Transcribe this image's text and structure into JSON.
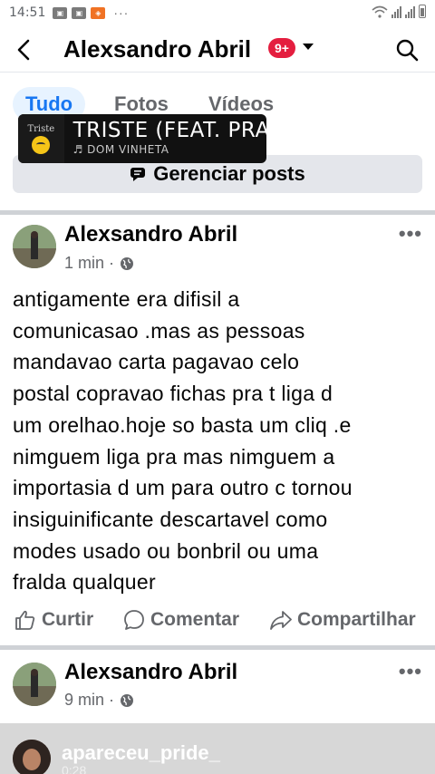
{
  "status_bar": {
    "time": "14:51",
    "more_indicator": "···",
    "notification_icons": [
      "gallery-icon",
      "gallery-icon",
      "app-notification-icon"
    ]
  },
  "header": {
    "title": "Alexsandro Abril",
    "badge": "9+",
    "back_icon": "arrow-left-icon",
    "search_icon": "search-icon"
  },
  "tabs": [
    {
      "label": "Tudo",
      "active": true
    },
    {
      "label": "Fotos",
      "active": false
    },
    {
      "label": "Vídeos",
      "active": false
    }
  ],
  "music_sticker": {
    "album_text": "Triste",
    "song": "TRISTE (FEAT. PRAV",
    "artist": "♬ DOM VINHETA"
  },
  "manage_posts": {
    "label": "Gerenciar posts"
  },
  "post1": {
    "author": "Alexsandro Abril",
    "time": "1 min ·",
    "text_lines": [
      "antigamente era difisil a",
      "comunicasao .mas as pessoas",
      "mandavao carta pagavao celo",
      "postal copravao fichas pra t liga d",
      "um orelhao.hoje so basta um cliq .e",
      "nimguem liga pra mas nimguem a",
      "importasia d um para outro c tornou",
      "insiguinificante descartavel como",
      "modes usado ou bonbril ou uma",
      "fralda qualquer"
    ],
    "more": "•••"
  },
  "actions": {
    "like": "Curtir",
    "comment": "Comentar",
    "share": "Compartilhar"
  },
  "post2": {
    "author": "Alexsandro Abril",
    "time": "9 min ·",
    "more": "•••"
  },
  "shared": {
    "name": "apareceu_pride_",
    "time": "0:28"
  },
  "colors": {
    "accent": "#1877f2",
    "badge": "#e41e3f",
    "text": "#050505",
    "muted": "#65676b",
    "tab_active_bg": "#e7f3ff",
    "button_bg": "#e4e6eb"
  }
}
